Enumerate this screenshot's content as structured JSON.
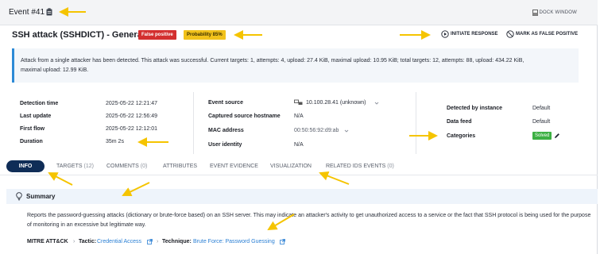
{
  "header": {
    "event_title": "Event #41",
    "dock_label": "DOCK WINDOW"
  },
  "title_row": {
    "title": "SSH attack (SSHDICT) - General",
    "badge_false_positive": "False positive",
    "badge_probability": "Probability 85%",
    "action_initiate": "INITIATE RESPONSE",
    "action_mark_fp": "MARK AS FALSE POSITIVE"
  },
  "description": {
    "line1": "Attack from a single attacker has been detected. This attack was successful. Current targets: 1, attempts: 4, upload: 27.4 KiB, maximal upload: 10.95 KiB; total targets: 12, attempts: 88, upload: 434.22 KiB,",
    "line2": "maximal upload: 12.99 KiB."
  },
  "details": {
    "col1": [
      {
        "label": "Detection time",
        "value": "2025-05-22 12:21:47"
      },
      {
        "label": "Last update",
        "value": "2025-05-22 12:56:49"
      },
      {
        "label": "First flow",
        "value": "2025-05-22 12:12:01"
      },
      {
        "label": "Duration",
        "value": "35m 2s"
      }
    ],
    "col2": [
      {
        "label": "Event source",
        "value": "10.100.28.41 (unknown)"
      },
      {
        "label": "Captured source hostname",
        "value": "N/A"
      },
      {
        "label": "MAC address",
        "value": "00:50:56:92:d9:ab"
      },
      {
        "label": "User identity",
        "value": "N/A"
      }
    ],
    "col3": [
      {
        "label": "Detected by instance",
        "value": "Default"
      },
      {
        "label": "Data feed",
        "value": "Default"
      },
      {
        "label": "Categories",
        "value": "Solved"
      }
    ]
  },
  "tabs": [
    {
      "label": "INFO",
      "count": ""
    },
    {
      "label": "TARGETS",
      "count": "(12)"
    },
    {
      "label": "COMMENTS",
      "count": "(0)"
    },
    {
      "label": "ATTRIBUTES",
      "count": ""
    },
    {
      "label": "EVENT EVIDENCE",
      "count": ""
    },
    {
      "label": "VISUALIZATION",
      "count": ""
    },
    {
      "label": "RELATED IDS EVENTS",
      "count": "(0)"
    }
  ],
  "summary": {
    "title": "Summary",
    "text": "Reports the password-guessing attacks (dictionary or brute-force based) on an SSH server. This may indicate an attacker's activity to get unauthorized access to a service or the fact that SSH protocol is being used for the purpose of monitoring in an excessive but legitimate way.",
    "mitre_label": "MITRE ATT&CK",
    "tactic_label": "Tactic:",
    "tactic_value": "Credential Access",
    "technique_label": "Technique:",
    "technique_value": "Brute Force: Password Guessing"
  },
  "colors": {
    "accent_navy": "#0f2d57",
    "false_positive_red": "#d32f2f",
    "probability_yellow": "#f2c21b",
    "solved_green": "#3cb043",
    "link_blue": "#2a7fd4",
    "annotation_arrow": "#f5c400"
  },
  "icons": [
    "clipboard-icon",
    "dock-window-icon",
    "play-circle-icon",
    "ban-icon",
    "network-icon",
    "chevron-down-icon",
    "pencil-icon",
    "lightbulb-icon",
    "external-link-icon"
  ]
}
